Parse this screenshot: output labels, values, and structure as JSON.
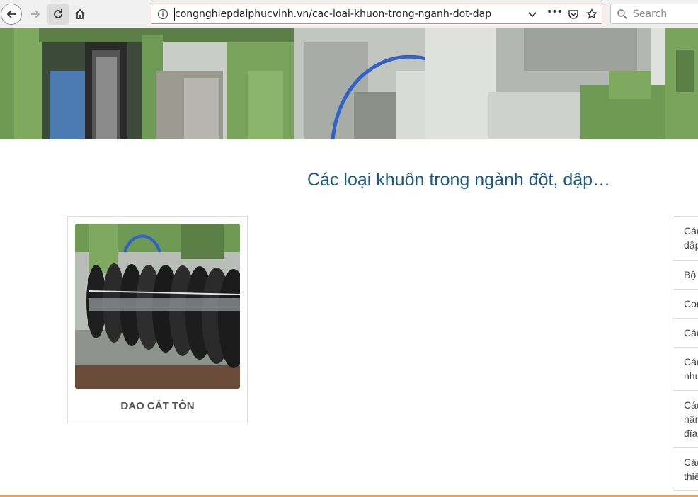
{
  "browser": {
    "url": "congnghiepdaiphucvinh.vn/cac-loai-khuon-trong-nganh-dot-dap",
    "search_placeholder": "Search",
    "url_dots": "•••"
  },
  "page": {
    "title": "Các loại khuôn trong ngành đột, dập…"
  },
  "products": [
    {
      "name": "DAO CẮT TÔN"
    }
  ],
  "sidebar": {
    "items": [
      {
        "label": "Các\ndập"
      },
      {
        "label": "Bộ"
      },
      {
        "label": "Cor"
      },
      {
        "label": "Các"
      },
      {
        "label": "Các\nnhư"
      },
      {
        "label": "Các\nnân\nđĩa"
      },
      {
        "label": "Các\nthiế"
      }
    ]
  },
  "colors": {
    "title": "#1d5a86",
    "url_border": "#e4877a",
    "footer_accent": "#f0a15a"
  }
}
